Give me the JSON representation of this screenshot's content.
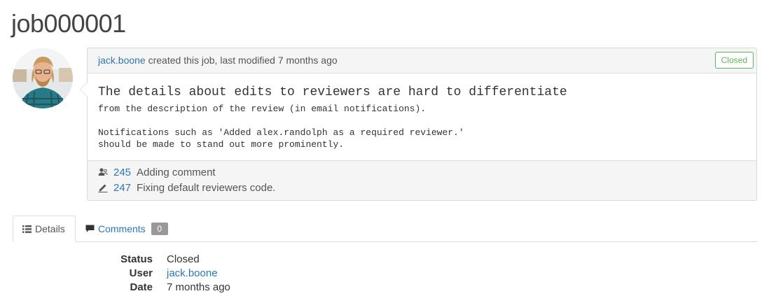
{
  "page": {
    "title": "job000001"
  },
  "job": {
    "creator": "jack.boone",
    "created_text": "created this job, last modified",
    "modified": "7 months ago",
    "status_label": "Closed",
    "description": {
      "title": "The details about edits to reviewers are hard to differentiate",
      "line1": "from the description of the review (in email notifications).",
      "line2": "Notifications such as 'Added alex.randolph as a required reviewer.'",
      "line3": "should be made to stand out more prominently."
    },
    "changes": [
      {
        "icon": "review-icon",
        "id": "245",
        "text": "Adding comment"
      },
      {
        "icon": "pencil-icon",
        "id": "247",
        "text": "Fixing default reviewers code."
      }
    ]
  },
  "tabs": {
    "details": {
      "icon": "list-icon",
      "label": "Details"
    },
    "comments": {
      "icon": "comment-icon",
      "label": "Comments",
      "count": "0"
    }
  },
  "details": {
    "status_label": "Status",
    "status_value": "Closed",
    "user_label": "User",
    "user_value": "jack.boone",
    "date_label": "Date",
    "date_value": "7 months ago"
  },
  "colors": {
    "link": "#2b78b4",
    "closed_status": "#5cb85c",
    "badge": "#999999"
  }
}
